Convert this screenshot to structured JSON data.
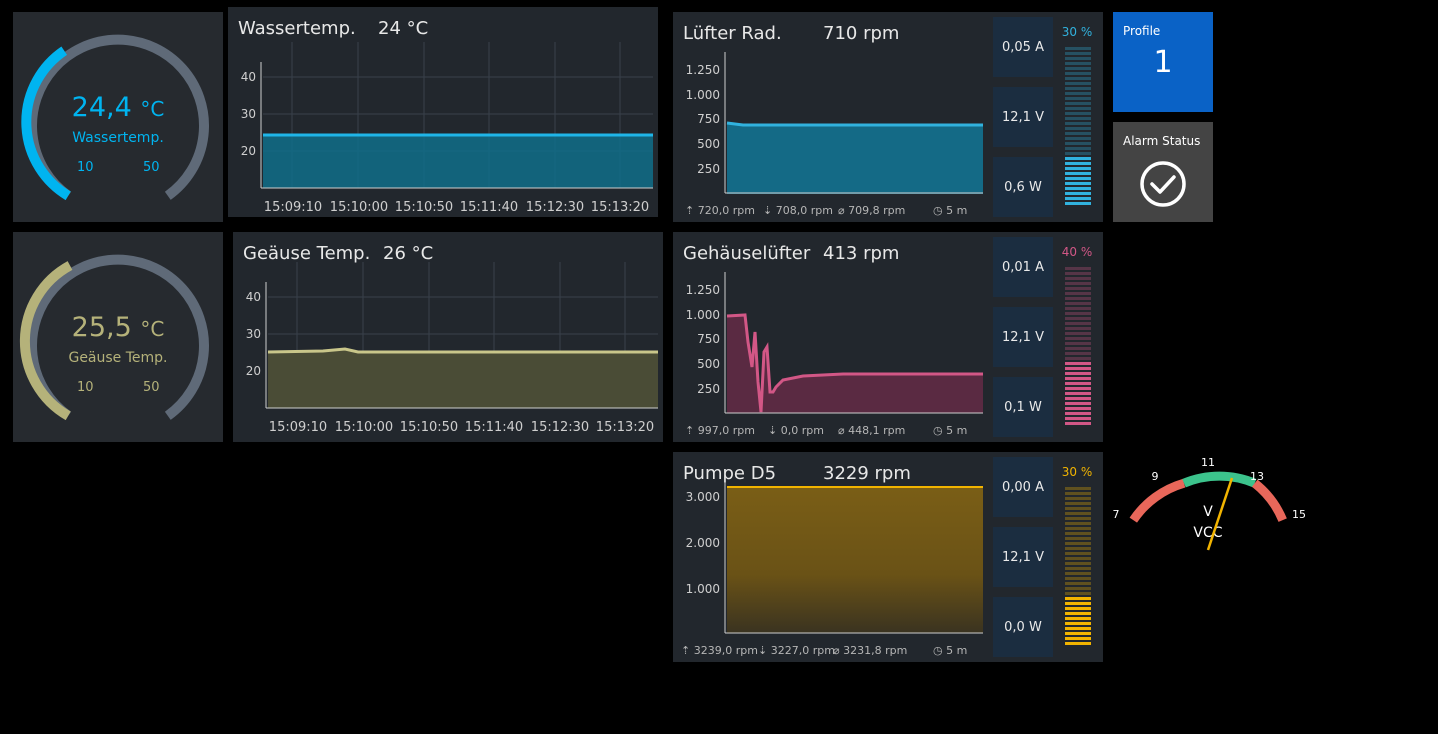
{
  "colors": {
    "water": "#00b4f0",
    "case": "#b5b27a",
    "track": "#5f6a78",
    "fan": "#31b2de",
    "fan2": "#d25786",
    "pump": "#f2b400",
    "blue_tile": "#0a62c6"
  },
  "gauges": [
    {
      "value": "24,4",
      "unit": "°C",
      "label": "Wassertemp.",
      "min": "10",
      "max": "50",
      "fraction": 0.36
    },
    {
      "value": "25,5",
      "unit": "°C",
      "label": "Geäuse Temp.",
      "min": "10",
      "max": "50",
      "fraction": 0.39
    }
  ],
  "temp_charts": [
    {
      "title": "Wassertemp.",
      "value": "24 °C",
      "yticks": [
        "40",
        "30",
        "20"
      ],
      "xticks": [
        "15:09:10",
        "15:10:00",
        "15:10:50",
        "15:11:40",
        "15:12:30",
        "15:13:20"
      ]
    },
    {
      "title": "Geäuse Temp.",
      "value": "26 °C",
      "yticks": [
        "40",
        "30",
        "20"
      ],
      "xticks": [
        "15:09:10",
        "15:10:00",
        "15:10:50",
        "15:11:40",
        "15:12:30",
        "15:13:20"
      ]
    }
  ],
  "fans": [
    {
      "title": "Lüfter Rad.",
      "value": "710 rpm",
      "yticks": [
        "1.250",
        "1.000",
        "750",
        "500",
        "250"
      ],
      "stats": [
        "0,05 A",
        "12,1 V",
        "0,6 W"
      ],
      "pct": "30 %",
      "pct_level": 0.3,
      "foot_max": "720,0 rpm",
      "foot_min": "708,0 rpm",
      "foot_avg": "709,8 rpm",
      "foot_time": "5 m"
    },
    {
      "title": "Gehäuselüfter",
      "value": "413 rpm",
      "yticks": [
        "1.250",
        "1.000",
        "750",
        "500",
        "250"
      ],
      "stats": [
        "0,01 A",
        "12,1 V",
        "0,1 W"
      ],
      "pct": "40 %",
      "pct_level": 0.4,
      "foot_max": "997,0 rpm",
      "foot_min": "0,0 rpm",
      "foot_avg": "448,1 rpm",
      "foot_time": "5 m"
    },
    {
      "title": "Pumpe D5",
      "value": "3229 rpm",
      "yticks": [
        "3.000",
        "2.000",
        "1.000"
      ],
      "stats": [
        "0,00 A",
        "12,1 V",
        "0,0 W"
      ],
      "pct": "30 %",
      "pct_level": 0.3,
      "foot_max": "3239,0 rpm",
      "foot_min": "3227,0 rpm",
      "foot_avg": "3231,8 rpm",
      "foot_time": "5 m"
    }
  ],
  "profile": {
    "label": "Profile",
    "value": "1"
  },
  "alarm": {
    "label": "Alarm Status"
  },
  "vcc": {
    "ticks": [
      "7",
      "9",
      "11",
      "13",
      "15"
    ],
    "unit": "V",
    "label": "VCC",
    "value": 12.1
  }
}
